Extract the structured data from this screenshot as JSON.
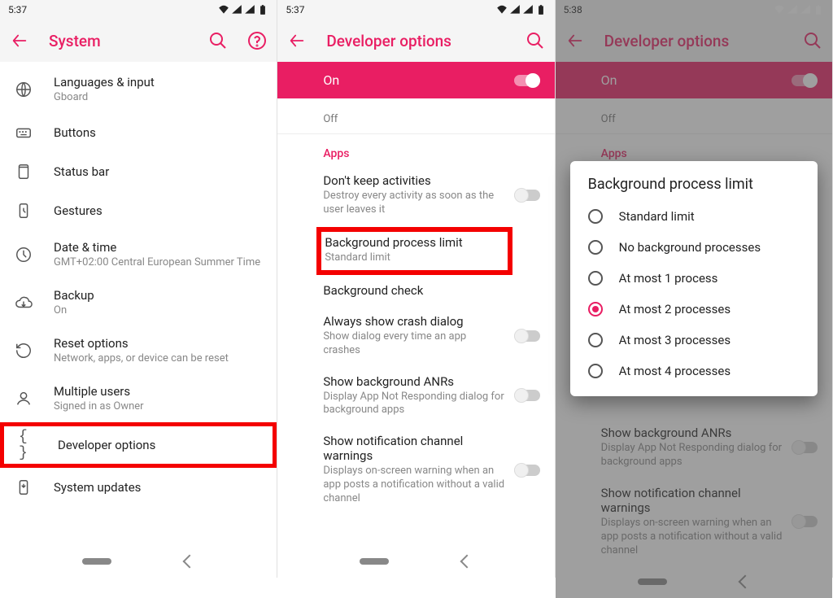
{
  "status": {
    "time1": "5:37",
    "time2": "5:37",
    "time3": "5:38"
  },
  "phone1": {
    "title": "System",
    "items": [
      {
        "label": "Languages & input",
        "sub": "Gboard"
      },
      {
        "label": "Buttons",
        "sub": ""
      },
      {
        "label": "Status bar",
        "sub": ""
      },
      {
        "label": "Gestures",
        "sub": ""
      },
      {
        "label": "Date & time",
        "sub": "GMT+02:00 Central European Summer Time"
      },
      {
        "label": "Backup",
        "sub": "On"
      },
      {
        "label": "Reset options",
        "sub": "Network, apps, or device can be reset"
      },
      {
        "label": "Multiple users",
        "sub": "Signed in as Owner"
      },
      {
        "label": "Developer options",
        "sub": ""
      },
      {
        "label": "System updates",
        "sub": ""
      }
    ]
  },
  "phone2": {
    "title": "Developer options",
    "master": "On",
    "peek": {
      "title": "",
      "sub": "Off"
    },
    "section": "Apps",
    "opts": [
      {
        "title": "Don't keep activities",
        "sub": "Destroy every activity as soon as the user leaves it",
        "switch": true
      },
      {
        "title": "Background process limit",
        "sub": "Standard limit",
        "highlight": true
      },
      {
        "title": "Background check",
        "sub": ""
      },
      {
        "title": "Always show crash dialog",
        "sub": "Show dialog every time an app crashes",
        "switch": true
      },
      {
        "title": "Show background ANRs",
        "sub": "Display App Not Responding dialog for background apps",
        "switch": true
      },
      {
        "title": "Show notification channel warnings",
        "sub": "Displays on-screen warning when an app posts a notification without a valid channel",
        "switch": true
      }
    ]
  },
  "phone3": {
    "title": "Developer options",
    "master": "On",
    "peek_sub": "Off",
    "section": "Apps",
    "bg_opts": [
      {
        "title": "Show background ANRs",
        "sub": "Display App Not Responding dialog for background apps"
      },
      {
        "title": "Show notification channel warnings",
        "sub": "Displays on-screen warning when an app posts a notification without a valid channel"
      }
    ],
    "dialog": {
      "title": "Background process limit",
      "options": [
        "Standard limit",
        "No background processes",
        "At most 1 process",
        "At most 2 processes",
        "At most 3 processes",
        "At most 4 processes"
      ],
      "selected": 3
    }
  }
}
